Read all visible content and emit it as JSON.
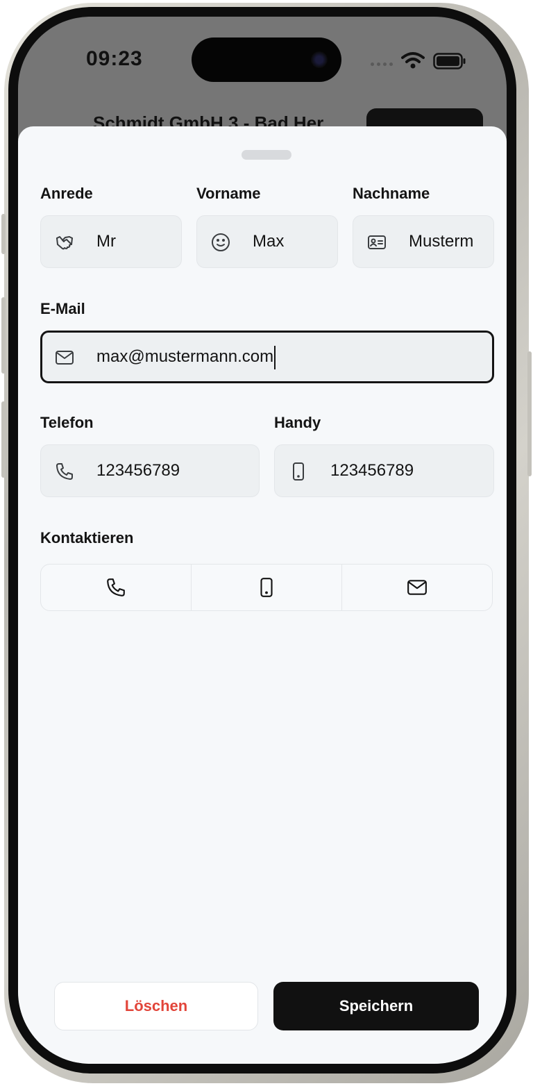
{
  "status_bar": {
    "time": "09:23"
  },
  "background_page": {
    "title": "Schmidt GmbH 3 - Bad Her"
  },
  "form": {
    "salutation": {
      "label": "Anrede",
      "value": "Mr",
      "icon": "handshake-icon"
    },
    "first_name": {
      "label": "Vorname",
      "value": "Max",
      "icon": "smiley-icon"
    },
    "last_name": {
      "label": "Nachname",
      "value": "Musterm",
      "icon": "id-card-icon"
    },
    "email": {
      "label": "E-Mail",
      "value": "max@mustermann.com",
      "icon": "mail-icon"
    },
    "phone": {
      "label": "Telefon",
      "value": "123456789",
      "icon": "phone-icon"
    },
    "mobile": {
      "label": "Handy",
      "value": "123456789",
      "icon": "mobile-icon"
    }
  },
  "contact": {
    "label": "Kontaktieren",
    "actions": [
      "phone-icon",
      "mobile-icon",
      "mail-icon"
    ]
  },
  "buttons": {
    "delete_label": "Löschen",
    "save_label": "Speichern"
  },
  "colors": {
    "delete_red": "#e2453a",
    "primary_black": "#111111",
    "sheet_bg": "#f6f8fa",
    "field_bg": "#edf0f2"
  }
}
